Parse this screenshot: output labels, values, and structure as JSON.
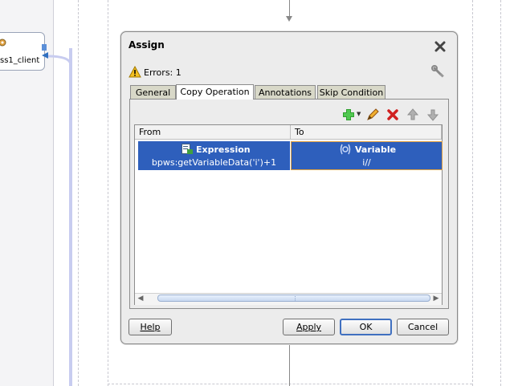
{
  "canvas": {
    "partner_label": "ss1_client"
  },
  "dialog": {
    "title": "Assign",
    "errors_text": "Errors: 1",
    "tabs": [
      {
        "label": "General",
        "active": false
      },
      {
        "label": "Copy Operation",
        "active": true
      },
      {
        "label": "Annotations",
        "active": false
      },
      {
        "label": "Skip Condition",
        "active": false
      }
    ],
    "toolbar": {
      "add_icon": "plus-green-icon",
      "edit_icon": "pencil-icon",
      "delete_icon": "red-x-icon",
      "move_up_icon": "arrow-up-icon",
      "move_down_icon": "arrow-down-icon"
    },
    "table": {
      "columns": [
        "From",
        "To"
      ],
      "rows": [
        {
          "from_type": "Expression",
          "from_value": "bpws:getVariableData('i')+1",
          "to_type": "Variable",
          "to_value": "i//"
        }
      ]
    },
    "buttons": {
      "help": "Help",
      "apply": "Apply",
      "ok": "OK",
      "cancel": "Cancel"
    }
  },
  "colors": {
    "selection": "#2e5fbc",
    "dialog_bg": "#ececec",
    "tab_inactive": "#d8d8c8"
  }
}
